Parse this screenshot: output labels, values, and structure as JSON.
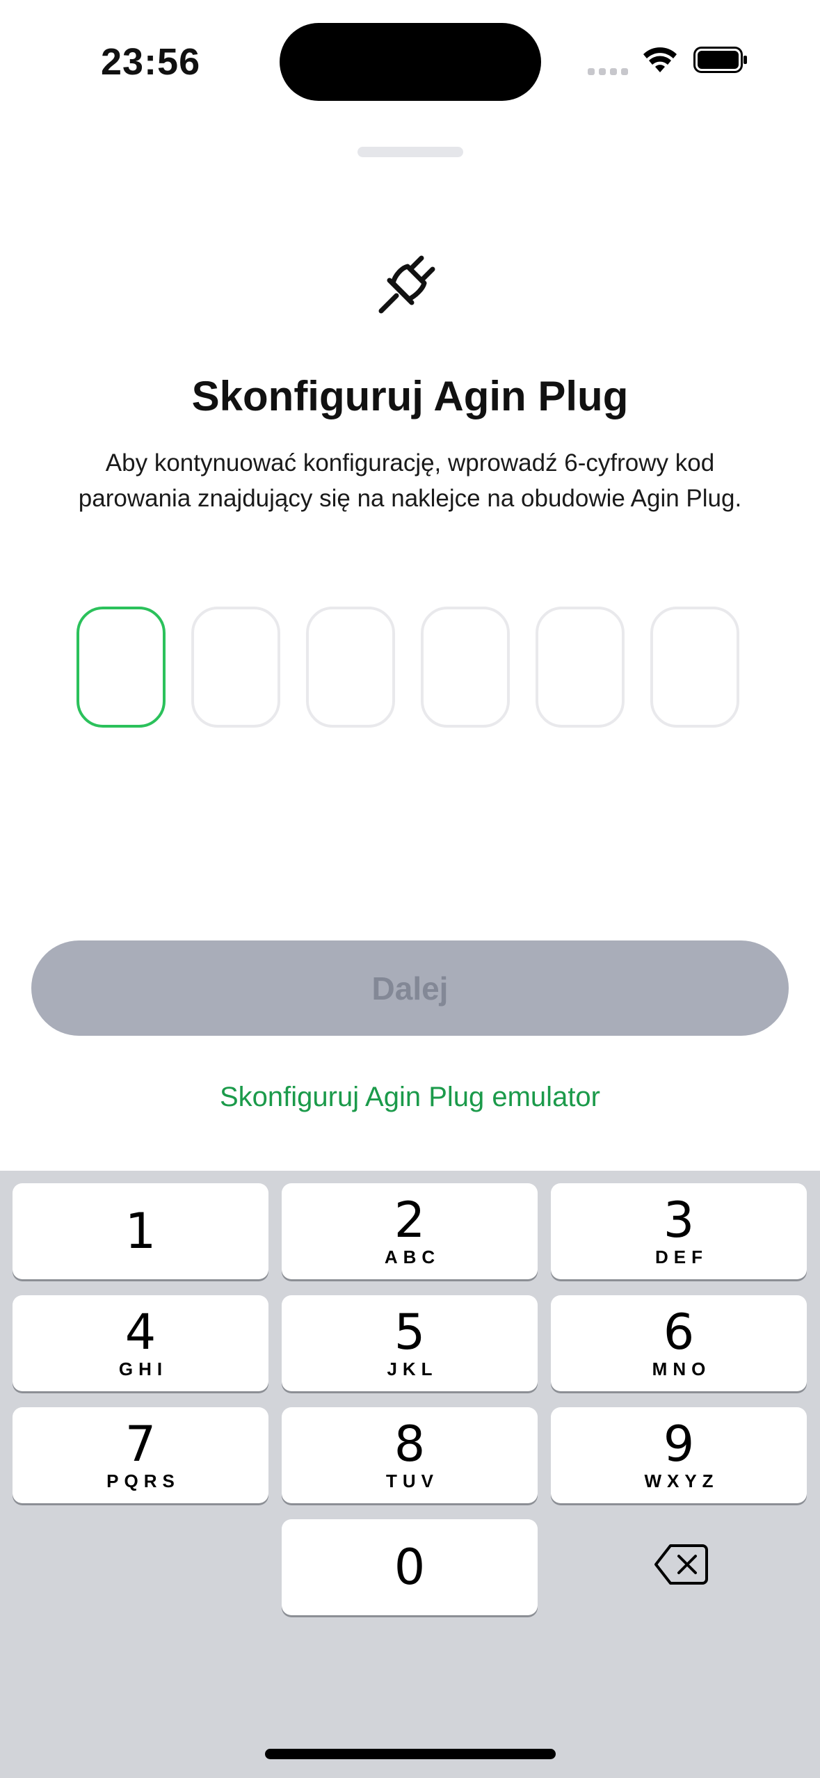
{
  "status_bar": {
    "time": "23:56"
  },
  "sheet": {
    "title": "Skonfiguruj Agin Plug",
    "subtitle": "Aby kontynuować konfigurację, wprowadź 6-cyfrowy kod parowania znajdujący się na naklejce na obudowie Agin Plug.",
    "code": {
      "length": 6,
      "digits": [
        "",
        "",
        "",
        "",
        "",
        ""
      ]
    },
    "next_label": "Dalej",
    "emulator_link": "Skonfiguruj Agin Plug emulator"
  },
  "keypad": {
    "keys": [
      {
        "num": "1",
        "letters": ""
      },
      {
        "num": "2",
        "letters": "ABC"
      },
      {
        "num": "3",
        "letters": "DEF"
      },
      {
        "num": "4",
        "letters": "GHI"
      },
      {
        "num": "5",
        "letters": "JKL"
      },
      {
        "num": "6",
        "letters": "MNO"
      },
      {
        "num": "7",
        "letters": "PQRS"
      },
      {
        "num": "8",
        "letters": "TUV"
      },
      {
        "num": "9",
        "letters": "WXYZ"
      },
      {
        "num": "0",
        "letters": ""
      }
    ]
  },
  "colors": {
    "accent": "#2bc15b",
    "link": "#1b9a4a",
    "button_disabled": "#a9adb9"
  },
  "icons": [
    "plug-icon",
    "wifi-icon",
    "battery-icon",
    "backspace-icon"
  ]
}
